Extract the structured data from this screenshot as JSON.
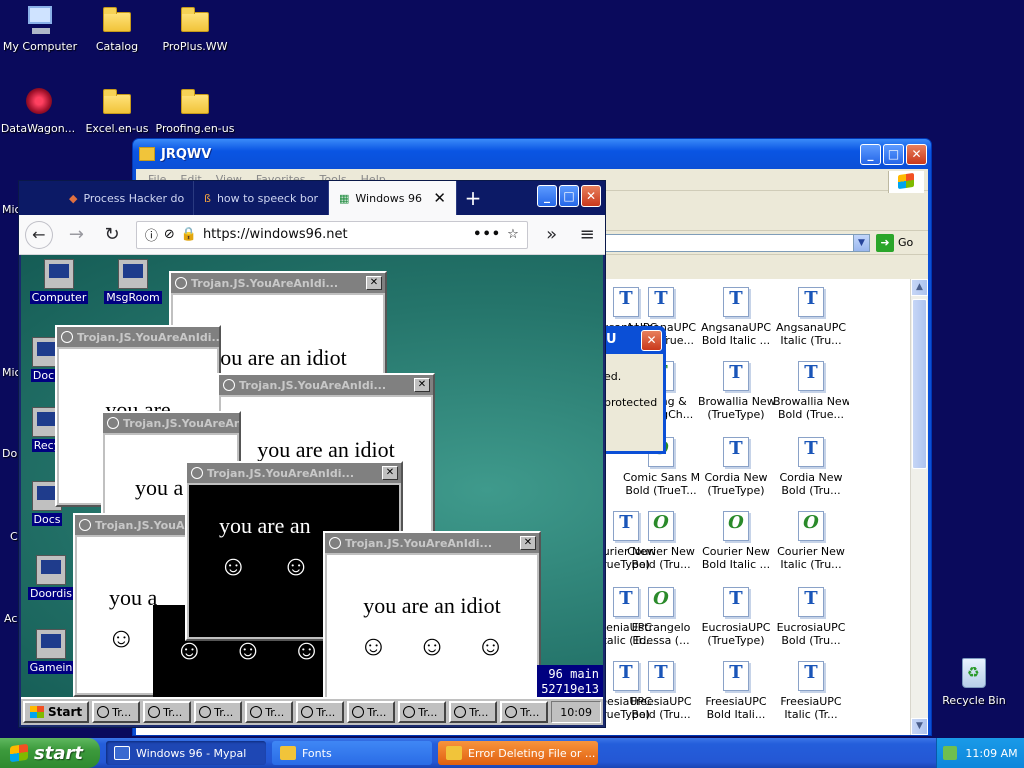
{
  "desktop": {
    "icons": [
      {
        "label": "My Computer"
      },
      {
        "label": "Catalog"
      },
      {
        "label": "ProPlus.WW"
      },
      {
        "label": "DataWagon..."
      },
      {
        "label": "Excel.en-us"
      },
      {
        "label": "Proofing.en-us"
      },
      {
        "label": "Recycle Bin"
      }
    ],
    "edge_labels": [
      "Mic",
      "Mic",
      "Do",
      "C",
      "Ac"
    ]
  },
  "explorer": {
    "title": "JRQWV",
    "menu": [
      "File",
      "Edit",
      "View",
      "Favorites",
      "Tools",
      "Help"
    ],
    "go_label": "Go",
    "fonts": [
      {
        "l1": "AngsanaUPC",
        "l2": "(TrueType)",
        "icon": "tt"
      },
      {
        "l1": "AngsanaUPC",
        "l2": "Bold (True...",
        "icon": "tt"
      },
      {
        "l1": "AngsanaUPC",
        "l2": "Bold Italic ...",
        "icon": "tt"
      },
      {
        "l1": "AngsanaUPC",
        "l2": "Italic (Tru...",
        "icon": "tt"
      },
      {
        "l1": "Batang &",
        "l2": "BatangCh...",
        "icon": "tt-green"
      },
      {
        "l1": "Browallia New",
        "l2": "(TrueType)",
        "icon": "tt"
      },
      {
        "l1": "Browallia New",
        "l2": "Bold (True...",
        "icon": "tt"
      },
      {
        "l1": "Comic Sans MS",
        "l2": "Bold (TrueT...",
        "icon": "o"
      },
      {
        "l1": "Cordia New",
        "l2": "(TrueType)",
        "icon": "tt"
      },
      {
        "l1": "Cordia New",
        "l2": "Bold (Tru...",
        "icon": "tt"
      },
      {
        "l1": "Courier New",
        "l2": "(TrueType)",
        "icon": "o"
      },
      {
        "l1": "Courier New",
        "l2": "Bold (Tru...",
        "icon": "o"
      },
      {
        "l1": "Courier New",
        "l2": "Bold Italic ...",
        "icon": "o"
      },
      {
        "l1": "Courier New",
        "l2": "Italic (Tru...",
        "icon": "o"
      },
      {
        "l1": "EucrosiaUPC",
        "l2": "Italic (Tr...",
        "icon": "tt"
      },
      {
        "l1": "Estrangelo",
        "l2": "Edessa (...",
        "icon": "o"
      },
      {
        "l1": "EucrosiaUPC",
        "l2": "(TrueType)",
        "icon": "tt"
      },
      {
        "l1": "EucrosiaUPC",
        "l2": "Bold (Tru...",
        "icon": "tt"
      },
      {
        "l1": "FreesiaUPC",
        "l2": "(TrueType)",
        "icon": "tt"
      },
      {
        "l1": "FreesiaUPC",
        "l2": "Bold (Tru...",
        "icon": "tt"
      },
      {
        "l1": "FreesiaUPC",
        "l2": "Bold Itali...",
        "icon": "tt"
      },
      {
        "l1": "FreesiaUPC",
        "l2": "Italic (Tr...",
        "icon": "tt"
      },
      {
        "l1": "",
        "l2": "",
        "icon": "a"
      },
      {
        "l1": "",
        "l2": "",
        "icon": "a"
      },
      {
        "l1": "",
        "l2": "",
        "icon": "a"
      },
      {
        "l1": "",
        "l2": "",
        "icon": "tt-green"
      }
    ],
    "visible_partial": {
      "col0_line1": [
        "ngsanaUPC",
        "",
        "",
        "ourier New",
        "lleniaUPC",
        "eesiaUPC"
      ],
      "col0_line2": [
        "rueType)",
        "",
        "",
        "rueType)",
        "Italic (Tr...",
        "rueType)"
      ]
    }
  },
  "error_dialog": {
    "title": "U",
    "line1": "ed.",
    "line2": "protected"
  },
  "browser": {
    "tabs": [
      {
        "label": "Process Hacker do"
      },
      {
        "label": "how to speeck bor"
      },
      {
        "label": "Windows 96",
        "active": true
      }
    ],
    "url": "https://windows96.net",
    "w96": {
      "icons": [
        {
          "label": "Computer"
        },
        {
          "label": "MsgRoom"
        },
        {
          "label": "Docu"
        },
        {
          "label": "Recy"
        },
        {
          "label": "Docs"
        },
        {
          "label": "Doordis"
        },
        {
          "label": "Gamein"
        }
      ],
      "popup_title": "Trojan.JS.YouAreAnIdi...",
      "popup_text": "you are an idiot",
      "popup_text_partial_a": "you are",
      "popup_text_partial_b": "you a",
      "popup_text_partial_c": "you are an",
      "popup_text_partial_d": "you a",
      "popup_text_partial_e": "you are an idiot",
      "face": "☺",
      "terminal_lines": [
        "96 main",
        "52719e13"
      ],
      "start_label": "Start",
      "task_label": "Tr...",
      "task_count": 9,
      "clock": "10:09"
    }
  },
  "taskbar": {
    "start_label": "start",
    "items": [
      {
        "label": "Windows 96 - Mypal"
      },
      {
        "label": "Fonts"
      },
      {
        "label": "Error Deleting File or ..."
      }
    ],
    "clock": "11:09 AM"
  }
}
